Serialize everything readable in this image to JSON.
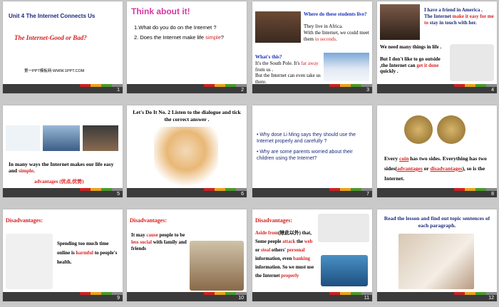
{
  "colors": {
    "red": "#d61f1f",
    "blue": "#1a2fb3",
    "navy": "#1b2a7a",
    "bar": "#3b3b3b"
  },
  "slides": [
    {
      "num": "1",
      "title": "Unit 4 The Internet Connects Us",
      "subtitle": "The Internet-Good or Bad?",
      "footer": "第一PPT模板网-WWW.1PPT.COM"
    },
    {
      "num": "2",
      "header": "Think about it!",
      "q1": "1.What do you do on the Internet ?",
      "q2a": "2. Does the Internet make life ",
      "q2b": "simple",
      "q2c": "?"
    },
    {
      "num": "3",
      "q": "Where do these students live?",
      "a1": "They live in Africa.",
      "a2a": "With the Internet, we could meet them ",
      "a2b": "in seconds",
      "a2c": ".",
      "q2": "What's this?",
      "s1a": "It's the South Pole. It's ",
      "s1b": "far away",
      "s1c": " from us .",
      "s2": "But the Internet can even take us there."
    },
    {
      "num": "4",
      "top1": "I have a friend in America .",
      "top2a": "The Internet ",
      "top2b": "make it easy for me to",
      "top2c": " stay in touch with her.",
      "bot1": "We need many things in life .",
      "bot2": "But I don't like to go outside ,the Internet can ",
      "bot3": "get it done",
      "bot4": " quickly ."
    },
    {
      "num": "5",
      "t1": "In many ways the Internet makes our life easy and ",
      "t2": "simple",
      "t3": ".",
      "t4": "advantages (优点,优势)"
    },
    {
      "num": "6",
      "title": "Let's Do It No. 2 Listen to the dialogue and tick the correct answer ."
    },
    {
      "num": "7",
      "b1": "Why dose Li Ming says they should use the Internet properly and carefully ?",
      "b2": "Why are some parents  worried about their children using the Internet?"
    },
    {
      "num": "8",
      "t1": "Every ",
      "t2": "coin",
      "t3": " has two sides. Everything has two  sides(",
      "t4": "advantages",
      "t5": " or ",
      "t6": "disadvantages",
      "t7": "), so is the Internet."
    },
    {
      "num": "9",
      "header": "Disadvantages:",
      "t1": "Spending too much time online is ",
      "t2": "harmful",
      "t3": " to people's health."
    },
    {
      "num": "10",
      "header": "Disadvantages:",
      "t1": "It may ",
      "t2": "cause",
      "t3": " people to be ",
      "t4": "less social",
      "t5": " with family and friends"
    },
    {
      "num": "11",
      "header": "Disadvantages:",
      "t1": "Aside from",
      "t2": "(除此以外)",
      "t3": " that, Some people ",
      "t4": "attack",
      "t5": " the ",
      "t6": "web",
      "t7": " or ",
      "t8": "steal",
      "t9": " others' ",
      "t10": "personal",
      "t11": " information, even ",
      "t12": "banking",
      "t13": " information. So we must use the Internet ",
      "t14": "properly"
    },
    {
      "num": "12",
      "title": "Read the lesson and find out topic sentences of each paragraph."
    }
  ],
  "icons": [
    "slide-bar-stripes",
    "photo-placeholder"
  ]
}
